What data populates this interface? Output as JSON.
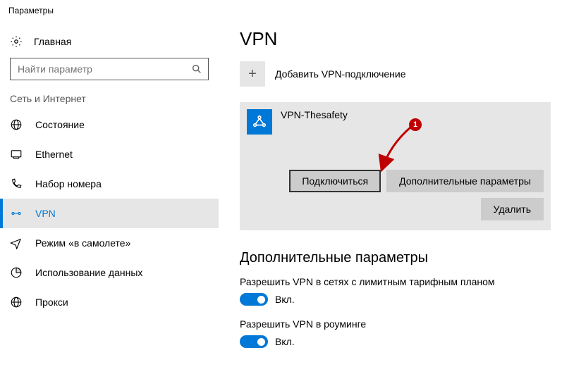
{
  "window": {
    "title": "Параметры"
  },
  "sidebar": {
    "home": "Главная",
    "search_placeholder": "Найти параметр",
    "section": "Сеть и Интернет",
    "items": [
      {
        "label": "Состояние"
      },
      {
        "label": "Ethernet"
      },
      {
        "label": "Набор номера"
      },
      {
        "label": "VPN"
      },
      {
        "label": "Режим «в самолете»"
      },
      {
        "label": "Использование данных"
      },
      {
        "label": "Прокси"
      }
    ]
  },
  "main": {
    "title": "VPN",
    "add_label": "Добавить VPN-подключение",
    "connection": {
      "name": "VPN-Thesafety",
      "connect": "Подключиться",
      "advanced": "Дополнительные параметры",
      "delete": "Удалить"
    },
    "extra": {
      "heading": "Дополнительные параметры",
      "allow_metered": "Разрешить VPN в сетях с лимитным тарифным планом",
      "allow_roaming": "Разрешить VPN в роуминге",
      "on_label": "Вкл."
    }
  },
  "annotation": {
    "badge": "1"
  }
}
